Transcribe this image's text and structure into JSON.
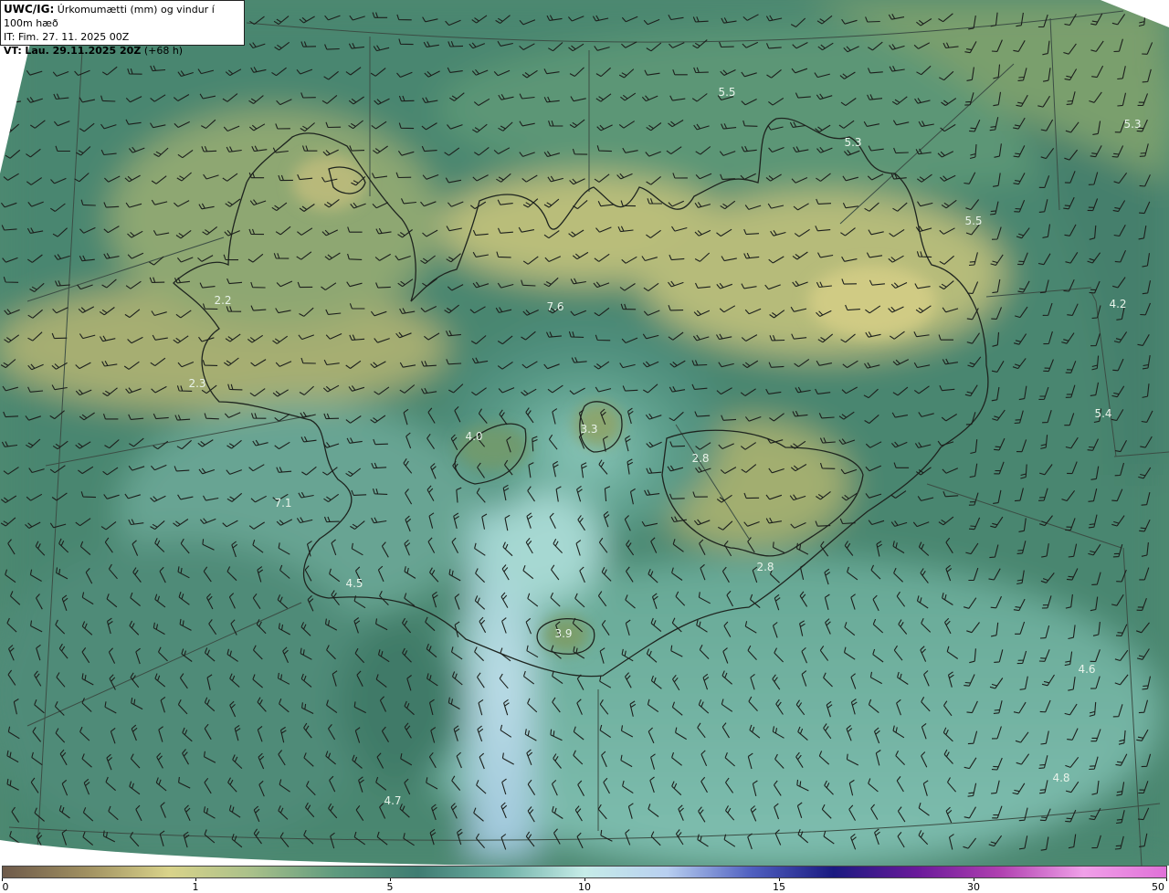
{
  "header": {
    "model": "UWC/IG:",
    "description": "Úrkomumætti (mm) og vindur í 100m hæð",
    "init_time": "IT: Fim. 27. 11. 2025 00Z",
    "valid_prefix": "VT:",
    "valid_time": "Lau. 29.11.2025 20Z",
    "lead": "(+68 h)"
  },
  "map_labels": [
    {
      "text": "5.5"
    },
    {
      "text": "5.3"
    },
    {
      "text": "5.3"
    },
    {
      "text": "5.5"
    },
    {
      "text": "4.2"
    },
    {
      "text": "5.4"
    },
    {
      "text": "7.6"
    },
    {
      "text": "4.0"
    },
    {
      "text": "3.3"
    },
    {
      "text": "2.8"
    },
    {
      "text": "7.1"
    },
    {
      "text": "4.5"
    },
    {
      "text": "2.8"
    },
    {
      "text": "3.9"
    },
    {
      "text": "4.6"
    },
    {
      "text": "4.8"
    },
    {
      "text": "4.7"
    },
    {
      "text": "2.2"
    },
    {
      "text": "2.3"
    }
  ],
  "colorbar": {
    "ticks": [
      "0",
      "1",
      "5",
      "10",
      "15",
      "30",
      "50"
    ],
    "colors": [
      "#6e5a4a",
      "#9f8f60",
      "#d9d38a",
      "#a9c08a",
      "#5e9a7e",
      "#3f7c72",
      "#6fb0a6",
      "#c6ece8",
      "#b8cff0",
      "#5060c0",
      "#1a1a80",
      "#6a1a9a",
      "#b040b0",
      "#f0a0e8",
      "#e070d8"
    ]
  }
}
